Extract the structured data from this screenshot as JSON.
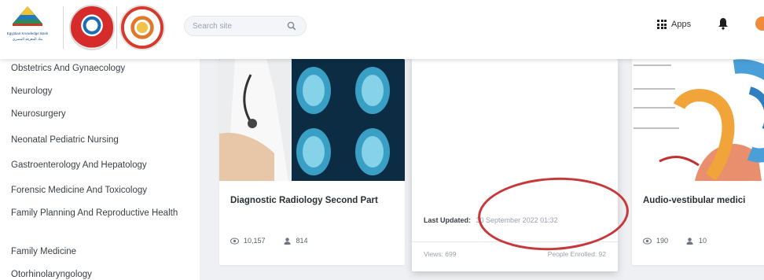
{
  "header": {
    "logo_caption_line1": "بنك المعرفة المصري",
    "logo_caption_line2": "Egyptian Knowledge Bank",
    "search_placeholder": "Search site",
    "apps_label": "Apps"
  },
  "sidebar": {
    "items": [
      {
        "label": "Obstetrics And Gynaecology"
      },
      {
        "label": "Neurology"
      },
      {
        "label": "Neurosurgery"
      },
      {
        "label": "Neonatal Pediatric Nursing"
      },
      {
        "label": "Gastroenterology And Hepatology"
      },
      {
        "label": "Forensic Medicine And Toxicology"
      },
      {
        "label": "Family Planning And Reproductive Health"
      },
      {
        "label": "Family Medicine"
      },
      {
        "label": "Otorhinolaryngology"
      }
    ]
  },
  "cards": [
    {
      "title": "Diagnostic Radiology Second Part",
      "views": "10,157",
      "learners": "814"
    },
    {
      "last_updated_label": "Last Updated:",
      "last_updated_value": "30 September 2022 01:32",
      "views_label": "Views: 699",
      "people_label": "People Enrolled: 92"
    },
    {
      "title": "Audio-vestibular medici",
      "views": "190",
      "learners": "10"
    }
  ],
  "colors": {
    "accent": "#f08a3c",
    "annotation": "#c8383a",
    "content_bg": "#eef0f3"
  },
  "icons": [
    "search-icon",
    "apps-grid-icon",
    "bell-icon",
    "eye-icon",
    "user-icon"
  ]
}
